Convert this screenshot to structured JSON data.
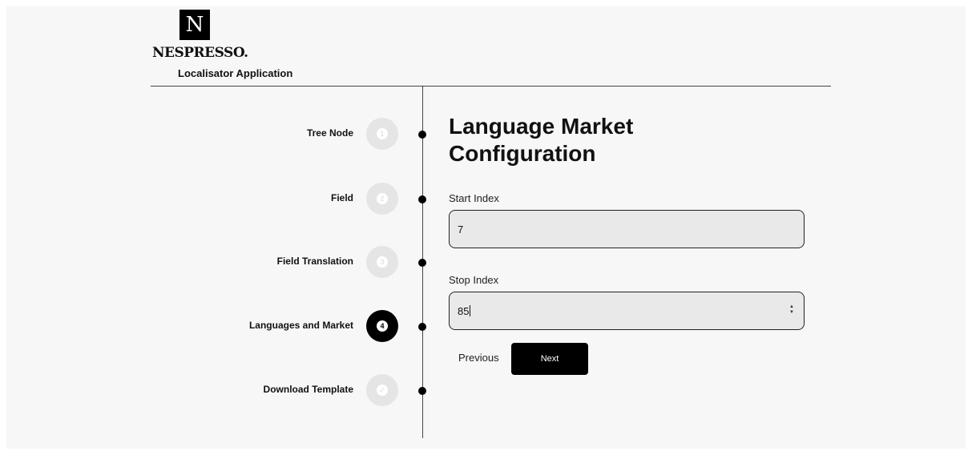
{
  "header": {
    "logo_letter": "N",
    "brand_name": "NESPRESSO.",
    "app_title": "Localisator Application"
  },
  "steps": [
    {
      "label": "Tree Node",
      "number": "1",
      "state": "inactive"
    },
    {
      "label": "Field",
      "number": "2",
      "state": "inactive"
    },
    {
      "label": "Field Translation",
      "number": "3",
      "state": "inactive"
    },
    {
      "label": "Languages and Market",
      "number": "4",
      "state": "active"
    },
    {
      "label": "Download Template",
      "icon": "check-icon",
      "state": "inactive"
    }
  ],
  "form": {
    "title": "Language Market Configuration",
    "start_index": {
      "label": "Start Index",
      "value": "7"
    },
    "stop_index": {
      "label": "Stop Index",
      "value": "85"
    }
  },
  "actions": {
    "previous_label": "Previous",
    "next_label": "Next"
  },
  "colors": {
    "active_step": "#000000",
    "inactive_step": "#e5e5e5",
    "primary_button": "#000000",
    "background": "#f7f7f7"
  }
}
